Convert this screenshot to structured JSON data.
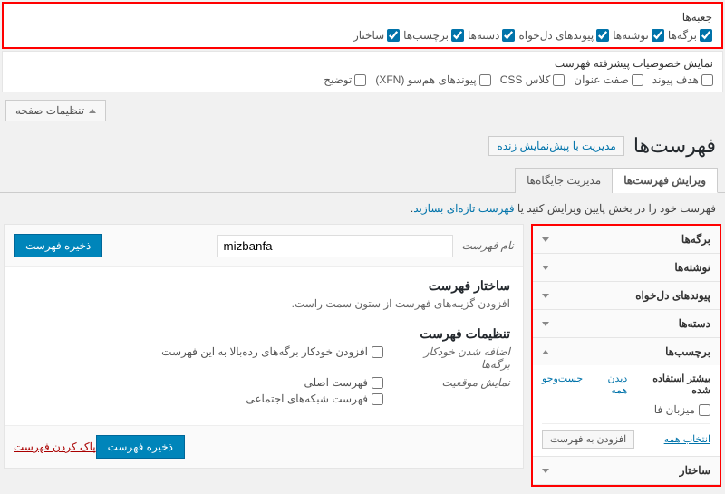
{
  "screen_options": {
    "title": "جعبه‌ها",
    "items": [
      {
        "label": "برگه‌ها",
        "checked": true
      },
      {
        "label": "نوشته‌ها",
        "checked": true
      },
      {
        "label": "پیوندهای دل‌خواه",
        "checked": true
      },
      {
        "label": "دسته‌ها",
        "checked": true
      },
      {
        "label": "برچسب‌ها",
        "checked": true
      },
      {
        "label": "ساختار",
        "checked": true
      }
    ]
  },
  "advanced": {
    "title": "نمایش خصوصیات پیشرفته فهرست",
    "items": [
      {
        "label": "هدف پیوند"
      },
      {
        "label": "صفت عنوان"
      },
      {
        "label": "کلاس CSS"
      },
      {
        "label": "پیوندهای هم‌سو (XFN)"
      },
      {
        "label": "توضیح"
      }
    ]
  },
  "toggle_label": "تنظیمات صفحه",
  "page_title": "فهرست‌ها",
  "live_preview": "مدیریت با پیش‌نمایش زنده",
  "tabs": {
    "edit": "ویرایش فهرست‌ها",
    "locations": "مدیریت جایگاه‌ها"
  },
  "hint_prefix": "فهرست خود را در بخش پایین ویرایش کنید یا ",
  "hint_link": "فهرست تازه‌ای بسازید",
  "hint_suffix": ".",
  "side": {
    "pages": "برگه‌ها",
    "posts": "نوشته‌ها",
    "links": "پیوندهای دل‌خواه",
    "cats": "دسته‌ها",
    "tags": "برچسب‌ها",
    "format": "ساختار",
    "mini_tabs": {
      "recent": "بیشتر استفاده شده",
      "all": "دیدن همه",
      "search": "جست‌وجو"
    },
    "tag_item": "میزبان فا",
    "select_all": "انتخاب همه",
    "add_to_menu": "افزودن به فهرست"
  },
  "editor": {
    "name_label": "نام فهرست",
    "name_value": "mizbanfa",
    "save": "ذخیره فهرست",
    "structure_h": "ساختار فهرست",
    "structure_p": "افزودن گزینه‌های فهرست از ستون سمت راست.",
    "settings_h": "تنظیمات فهرست",
    "auto_add_label": "اضافه شدن خودکار برگه‌ها",
    "auto_add_opt": "افزودن خودکار برگه‌های رده‌بالا به این فهرست",
    "display_label": "نمایش موقعیت",
    "loc1": "فهرست اصلی",
    "loc2": "فهرست شبکه‌های اجتماعی",
    "delete": "پاک کردن فهرست"
  }
}
